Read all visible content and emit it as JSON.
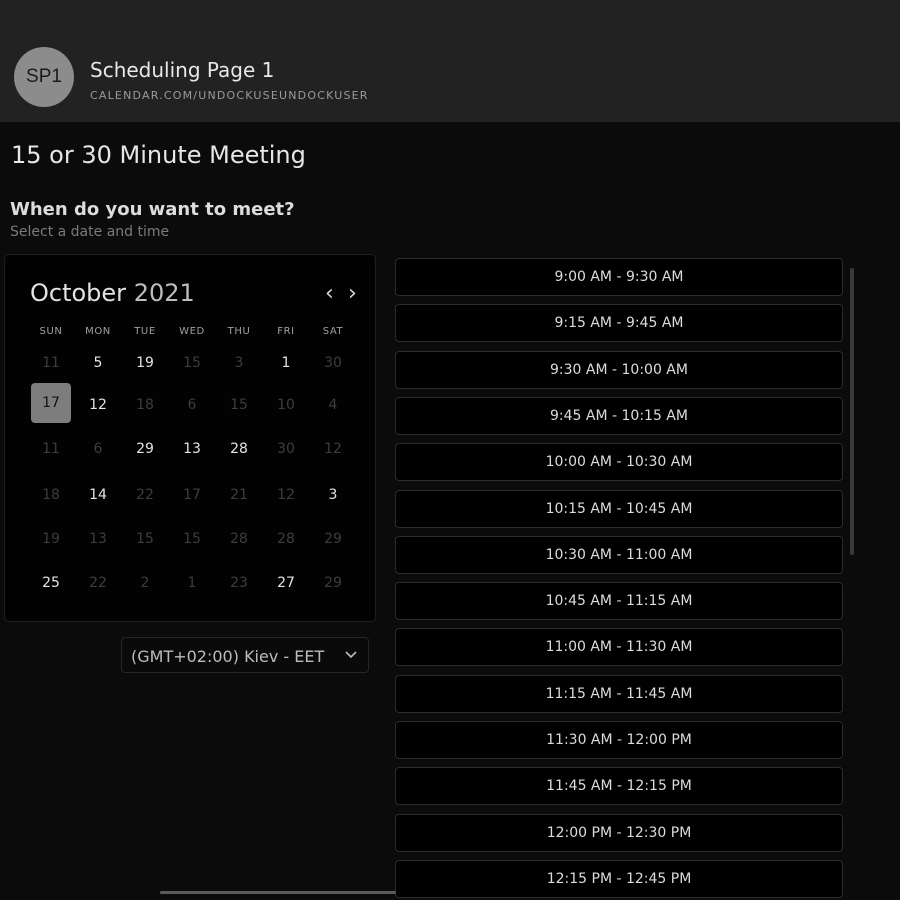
{
  "header": {
    "avatar_initials": "SP1",
    "page_name": "Scheduling Page 1",
    "url": "CALENDAR.COM/UNDOCKUSEUNDOCKUSER"
  },
  "meeting": {
    "title": "15 or 30 Minute Meeting",
    "question": "When do you want to meet?",
    "hint": "Select a date and time"
  },
  "calendar": {
    "month": "October",
    "year": "2021",
    "prev_icon": "chevron-left-icon",
    "next_icon": "chevron-right-icon",
    "weekdays": [
      "SUN",
      "MON",
      "TUE",
      "WED",
      "THU",
      "FRI",
      "SAT"
    ],
    "selected_day": "17",
    "weeks": [
      [
        {
          "d": "11",
          "a": false
        },
        {
          "d": "5",
          "a": true
        },
        {
          "d": "19",
          "a": true
        },
        {
          "d": "15",
          "a": false
        },
        {
          "d": "3",
          "a": false
        },
        {
          "d": "1",
          "a": true
        },
        {
          "d": "30",
          "a": false
        }
      ],
      [
        {
          "d": "17",
          "a": true,
          "sel": true
        },
        {
          "d": "12",
          "a": true
        },
        {
          "d": "18",
          "a": false
        },
        {
          "d": "6",
          "a": false
        },
        {
          "d": "15",
          "a": false
        },
        {
          "d": "10",
          "a": false
        },
        {
          "d": "4",
          "a": false
        }
      ],
      [
        {
          "d": "11",
          "a": false
        },
        {
          "d": "6",
          "a": false
        },
        {
          "d": "29",
          "a": true
        },
        {
          "d": "13",
          "a": true
        },
        {
          "d": "28",
          "a": true
        },
        {
          "d": "30",
          "a": false
        },
        {
          "d": "12",
          "a": false
        }
      ],
      [
        {
          "d": "18",
          "a": false
        },
        {
          "d": "14",
          "a": true
        },
        {
          "d": "22",
          "a": false
        },
        {
          "d": "17",
          "a": false
        },
        {
          "d": "21",
          "a": false
        },
        {
          "d": "12",
          "a": false
        },
        {
          "d": "3",
          "a": true
        }
      ],
      [
        {
          "d": "19",
          "a": false
        },
        {
          "d": "13",
          "a": false
        },
        {
          "d": "15",
          "a": false
        },
        {
          "d": "15",
          "a": false
        },
        {
          "d": "28",
          "a": false
        },
        {
          "d": "28",
          "a": false
        },
        {
          "d": "29",
          "a": false
        }
      ],
      [
        {
          "d": "25",
          "a": true
        },
        {
          "d": "22",
          "a": false
        },
        {
          "d": "2",
          "a": false
        },
        {
          "d": "1",
          "a": false
        },
        {
          "d": "23",
          "a": false
        },
        {
          "d": "27",
          "a": true
        },
        {
          "d": "29",
          "a": false
        }
      ]
    ]
  },
  "timezone": {
    "value": "(GMT+02:00) Kiev - EET",
    "icon": "chevron-down-icon"
  },
  "time_slots": [
    "9:00 AM - 9:30 AM",
    "9:15 AM - 9:45 AM",
    "9:30 AM - 10:00 AM",
    "9:45 AM - 10:15 AM",
    "10:00 AM - 10:30 AM",
    "10:15 AM - 10:45 AM",
    "10:30 AM - 11:00 AM",
    "10:45 AM - 11:15 AM",
    "11:00 AM - 11:30 AM",
    "11:15 AM - 11:45 AM",
    "11:30 AM - 12:00 PM",
    "11:45 AM - 12:15 PM",
    "12:00 PM - 12:30 PM",
    "12:15 PM - 12:45 PM"
  ]
}
